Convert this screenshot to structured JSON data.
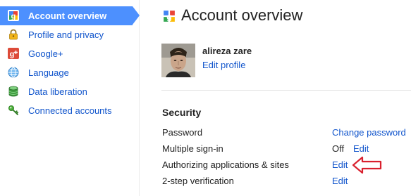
{
  "sidebar": {
    "items": [
      {
        "label": "Account overview",
        "icon": "google-icon",
        "active": true
      },
      {
        "label": "Profile and privacy",
        "icon": "lock-icon"
      },
      {
        "label": "Google+",
        "icon": "google-plus-icon"
      },
      {
        "label": "Language",
        "icon": "globe-icon"
      },
      {
        "label": "Data liberation",
        "icon": "database-icon"
      },
      {
        "label": "Connected accounts",
        "icon": "key-icon"
      }
    ]
  },
  "main": {
    "title": "Account overview",
    "profile": {
      "name": "alireza zare",
      "edit_label": "Edit profile"
    },
    "security": {
      "title": "Security",
      "rows": [
        {
          "label": "Password",
          "status": "",
          "action": "Change password"
        },
        {
          "label": "Multiple sign-in",
          "status": "Off",
          "action": "Edit"
        },
        {
          "label": "Authorizing applications & sites",
          "status": "",
          "action": "Edit"
        },
        {
          "label": "2-step verification",
          "status": "",
          "action": "Edit"
        }
      ]
    }
  },
  "colors": {
    "accent": "#4d90fe",
    "link": "#1155cc",
    "annotation": "#d9202e"
  }
}
